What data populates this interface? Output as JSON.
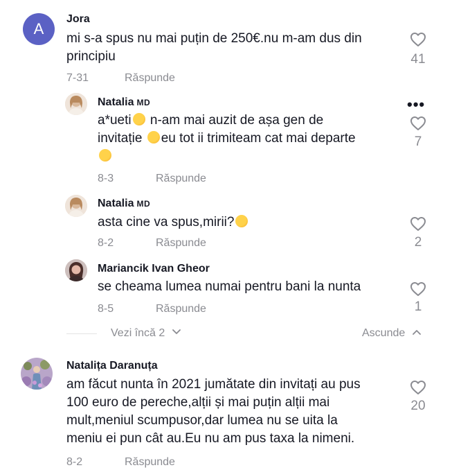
{
  "comments": [
    {
      "avatar_letter": "A",
      "author": "Jora",
      "text_lines": [
        "mi s-a spus nu mai puțin de 250€.nu m-am dus din",
        "principiu"
      ],
      "date": "7-31",
      "reply_label": "Răspunde",
      "likes": "41"
    }
  ],
  "replies": [
    {
      "author": "Natalia",
      "tag": "MD",
      "line1a": "a*ueti",
      "line1b": " n-am mai auzit de așa gen de",
      "line2a": "invitație ",
      "line2b": "eu tot ii trimiteam cat mai departe",
      "date": "8-3",
      "reply_label": "Răspunde",
      "likes": "7",
      "more_label": "•••"
    },
    {
      "author": "Natalia",
      "tag": "MD",
      "text": "asta cine va spus,mirii?",
      "date": "8-2",
      "reply_label": "Răspunde",
      "likes": "2"
    },
    {
      "author": "Mariancik Ivan Gheor",
      "text": "se cheama lumea numai pentru bani la nunta",
      "date": "8-5",
      "reply_label": "Răspunde",
      "likes": "1"
    }
  ],
  "thread_controls": {
    "view_more": "Vezi încă 2",
    "hide": "Ascunde"
  },
  "comment2": {
    "author": "Natalița Daranuța",
    "text_lines": [
      "am făcut nunta în 2021 jumătate din invitați au pus",
      "100 euro de pereche,alții și mai puțin alții mai",
      "mult,meniul scumpusor,dar lumea nu se uita la",
      "meniu ei pun cât au.Eu nu am pus taxa la nimeni."
    ],
    "date": "8-2",
    "reply_label": "Răspunde",
    "likes": "20"
  },
  "colors": {
    "text": "#161823",
    "muted": "#8a8b91",
    "avatar_bg": "#5b61c4"
  },
  "icons": [
    "heart-outline-icon",
    "chevron-down-icon",
    "chevron-up-icon",
    "more-dots-icon"
  ]
}
